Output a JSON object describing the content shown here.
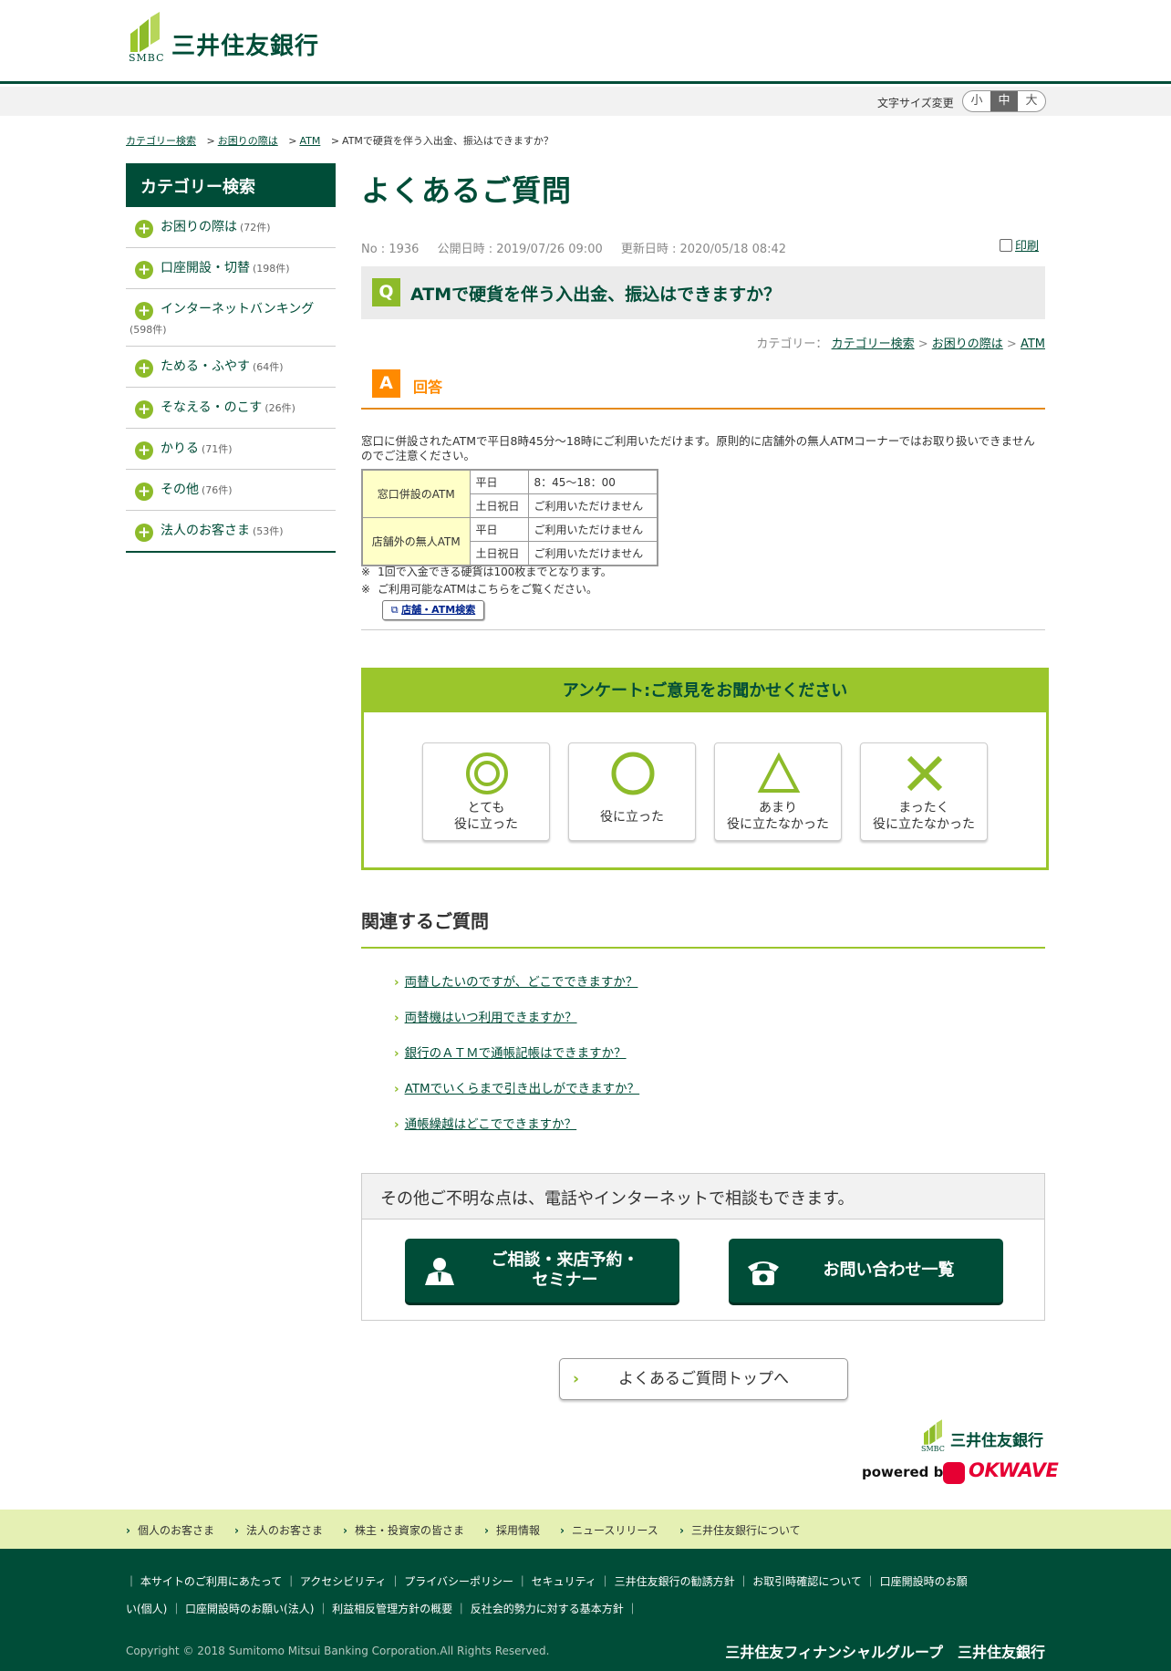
{
  "header": {
    "logo_abbr": "SMBC",
    "logo_name": "三井住友銀行",
    "font_size_label": "文字サイズ変更",
    "font_sizes": [
      "小",
      "中",
      "大"
    ]
  },
  "breadcrumb": [
    "カテゴリー検索",
    "お困りの際は",
    "ATM",
    "ATMで硬貨を伴う入出金、振込はできますか？"
  ],
  "sidebar": {
    "title": "カテゴリー検索",
    "items": [
      {
        "label": "お困りの際は",
        "count": "(72件)"
      },
      {
        "label": "口座開設・切替",
        "count": "(198件)"
      },
      {
        "label": "インターネットバンキング",
        "count": "(598件)"
      },
      {
        "label": "ためる・ふやす",
        "count": "(64件)"
      },
      {
        "label": "そなえる・のこす",
        "count": "(26件)"
      },
      {
        "label": "かりる",
        "count": "(71件)"
      },
      {
        "label": "その他",
        "count": "(76件)"
      },
      {
        "label": "法人のお客さま",
        "count": "(53件)"
      }
    ]
  },
  "main": {
    "title": "よくあるご質問",
    "meta": {
      "no": "No : 1936",
      "published": "公開日時 : 2019/07/26 09:00",
      "updated": "更新日時 : 2020/05/18 08:42"
    },
    "print_label": "印刷",
    "question": {
      "badge": "Q",
      "text": "ATMで硬貨を伴う入出金、振込はできますか？"
    },
    "category_prefix": "カテゴリー：",
    "category_links": [
      "カテゴリー検索",
      "お困りの際は",
      "ATM"
    ],
    "answer_badge": "A",
    "answer_heading": "回答",
    "answer_text": "窓口に併設されたATMで平日8時45分～18時にご利用いただけます。原則的に店舗外の無人ATMコーナーではお取り扱いできませんのでご注意ください。",
    "table": [
      {
        "place": "窓口併設のATM",
        "rows": [
          {
            "day": "平日",
            "value": "8：45～18：00"
          },
          {
            "day": "土日祝日",
            "value": "ご利用いただけません"
          }
        ]
      },
      {
        "place": "店舗外の無人ATM",
        "rows": [
          {
            "day": "平日",
            "value": "ご利用いただけません"
          },
          {
            "day": "土日祝日",
            "value": "ご利用いただけません"
          }
        ]
      }
    ],
    "notes": [
      {
        "mark": "※",
        "text": "1回で入金できる硬貨は100枚までとなります。"
      },
      {
        "mark": "※",
        "text": "ご利用可能なATMはこちらをご覧ください。"
      }
    ],
    "store_button": "店舗・ATM検索"
  },
  "survey": {
    "title": "アンケート:ご意見をお聞かせください",
    "options": [
      {
        "icon": "double-circle-icon",
        "line1": "とても",
        "line2": "役に立った"
      },
      {
        "icon": "circle-icon",
        "line1": "役に立った",
        "line2": ""
      },
      {
        "icon": "triangle-icon",
        "line1": "あまり",
        "line2": "役に立たなかった"
      },
      {
        "icon": "cross-icon",
        "line1": "まったく",
        "line2": "役に立たなかった"
      }
    ]
  },
  "related": {
    "title": "関連するご質問",
    "items": [
      "両替したいのですが、どこでできますか？",
      "両替機はいつ利用できますか？",
      "銀行のＡＴＭで通帳記帳はできますか？",
      "ATMでいくらまで引き出しができますか？",
      "通帳繰越はどこでできますか？"
    ]
  },
  "contact": {
    "title": "その他ご不明な点は、電話やインターネットで相談もできます。",
    "button1_line1": "ご相談・来店予約・",
    "button1_line2": "セミナー",
    "button2": "お問い合わせ一覧"
  },
  "faq_top": "よくあるご質問トップへ",
  "footer_brand": {
    "logo_abbr": "SMBC",
    "logo_name": "三井住友銀行",
    "powered_by": "powered by",
    "okwave": "OKWAVE"
  },
  "footer_nav": [
    "個人のお客さま",
    "法人のお客さま",
    "株主・投資家の皆さま",
    "採用情報",
    "ニュースリリース",
    "三井住友銀行について"
  ],
  "footer_links_row1": [
    "本サイトのご利用にあたって",
    "アクセシビリティ",
    "プライバシーポリシー",
    "セキュリティ",
    "三井住友銀行の勧誘方針",
    "お取引時確認について",
    "口座開設時のお願"
  ],
  "footer_links_row2": [
    "い(個人)",
    "口座開設時のお願い(法人)",
    "利益相反管理方針の概要",
    "反社会的勢力に対する基本方針"
  ],
  "copyright": "Copyright © 2018 Sumitomo Mitsui Banking Corporation.All Rights Reserved.",
  "footer_group": "三井住友フィナンシャルグループ　三井住友銀行",
  "colors": {
    "brand_green": "#004d38",
    "accent_lime": "#9bc62c",
    "answer_orange": "#ff8a00"
  }
}
